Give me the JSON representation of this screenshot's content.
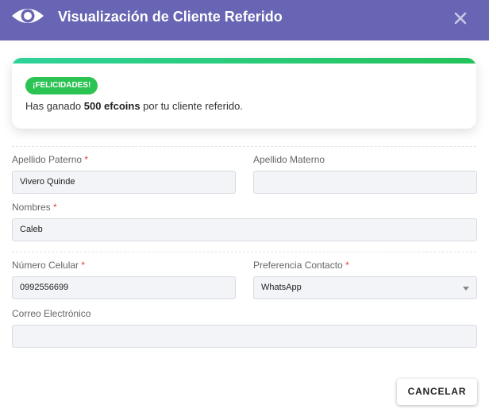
{
  "header": {
    "title": "Visualización de Cliente Referido",
    "icon": "eye-icon",
    "close_icon": "close-icon",
    "background": "#6865b4"
  },
  "banner": {
    "badge": "¡FELICIDADES!",
    "message_prefix": "Has ganado ",
    "message_highlight": "500 efcoins",
    "message_suffix": " por tu cliente referido.",
    "accent": "#2bc352"
  },
  "form": {
    "apellido_paterno": {
      "label": "Apellido Paterno",
      "required": "*",
      "value": "Vivero Quinde"
    },
    "apellido_materno": {
      "label": "Apellido Materno",
      "value": ""
    },
    "nombres": {
      "label": "Nombres",
      "required": "*",
      "value": "Caleb"
    },
    "numero_celular": {
      "label": "Número Celular",
      "required": "*",
      "value": "0992556699"
    },
    "preferencia_contacto": {
      "label": "Preferencia Contacto",
      "required": "*",
      "value": "WhatsApp"
    },
    "correo": {
      "label": "Correo Electrónico",
      "value": ""
    }
  },
  "footer": {
    "cancel_label": "CANCELAR"
  }
}
